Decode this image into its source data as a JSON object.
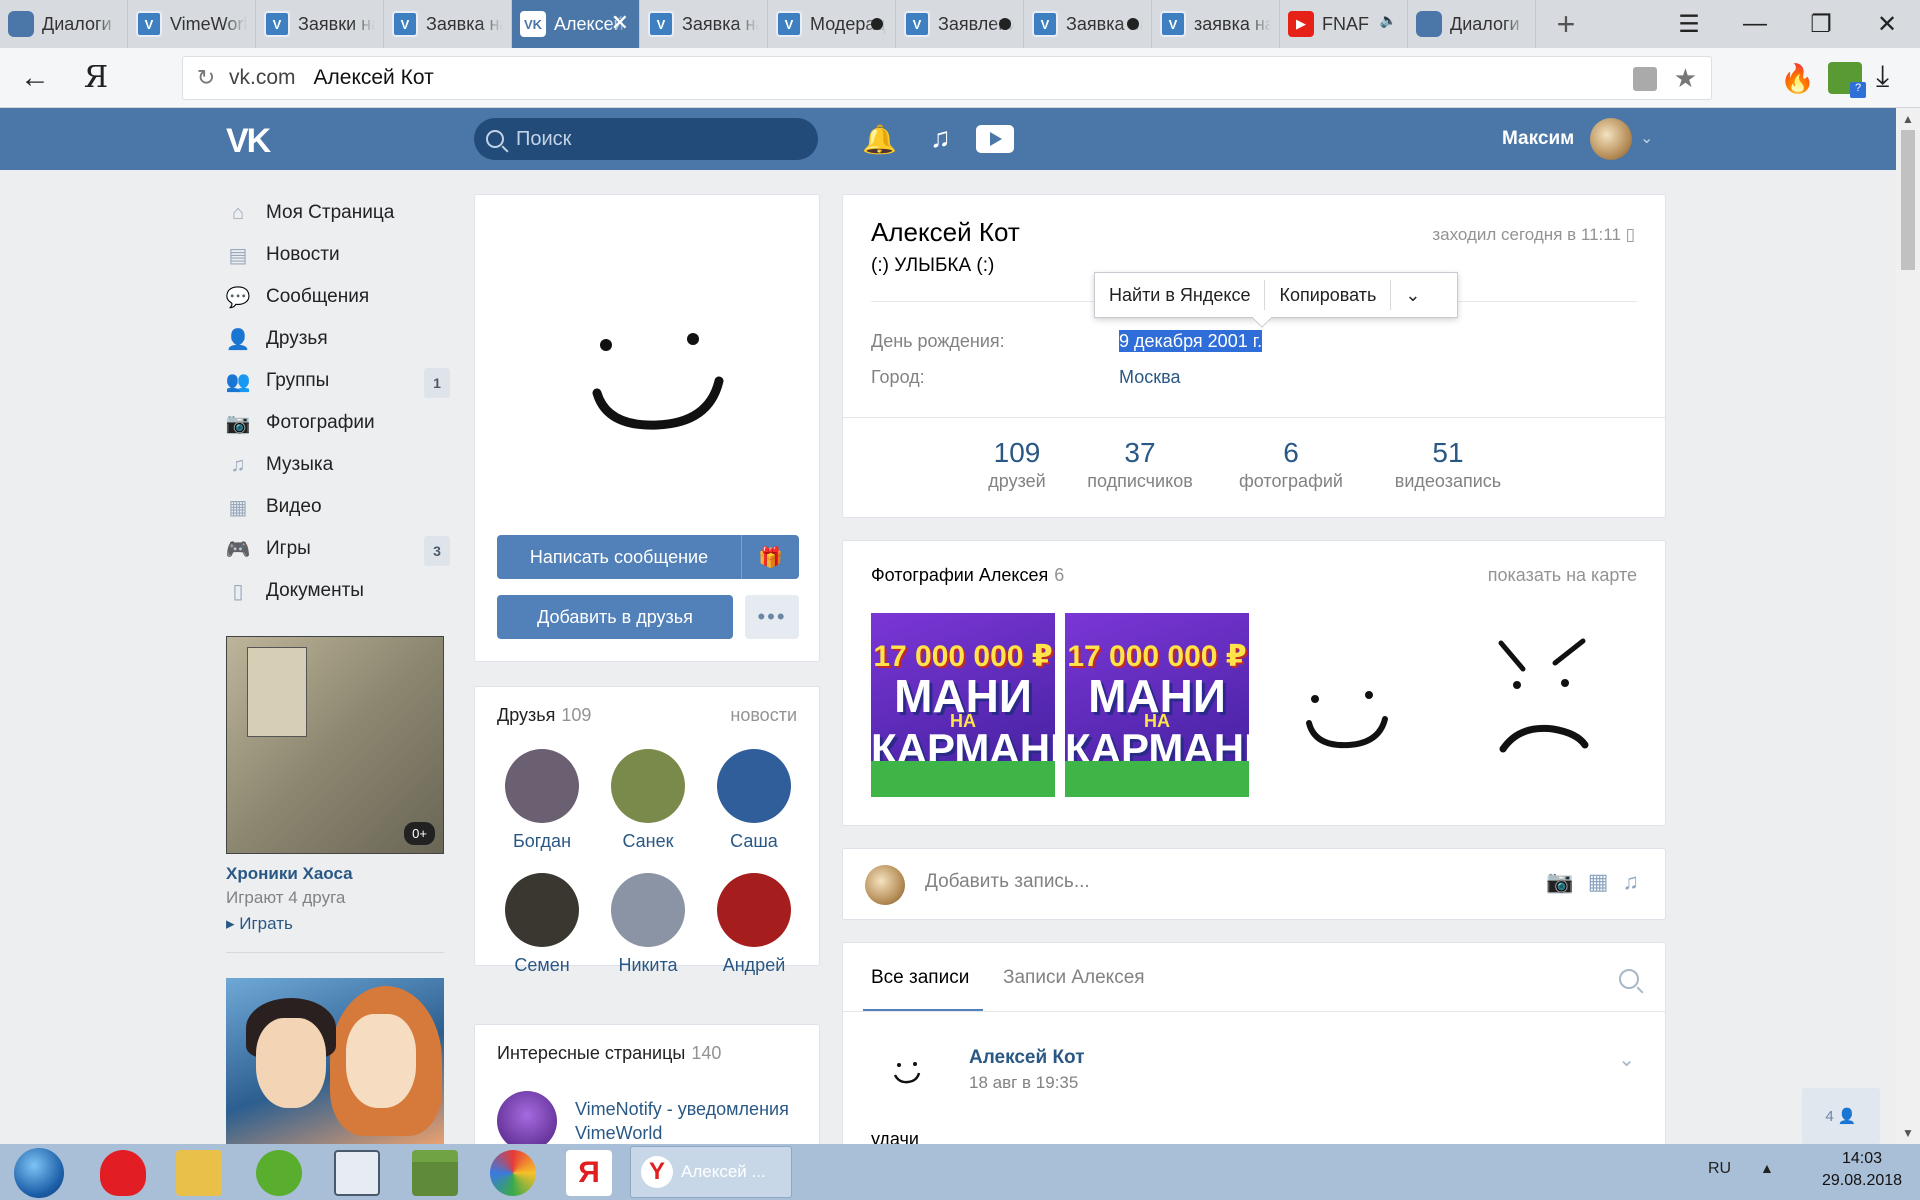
{
  "browser": {
    "tabs": [
      {
        "label": "Диалоги",
        "icon": "dialogs-icon"
      },
      {
        "label": "VimeWorld",
        "icon": "vimeworld-icon"
      },
      {
        "label": "Заявки на",
        "icon": "vimeworld-icon"
      },
      {
        "label": "Заявка на",
        "icon": "vimeworld-icon"
      },
      {
        "label": "Алексей Кот",
        "icon": "vk-icon",
        "active": true
      },
      {
        "label": "Заявка на",
        "icon": "vimeworld-icon"
      },
      {
        "label": "Модерация",
        "icon": "vimeworld-icon"
      },
      {
        "label": "Заявление",
        "icon": "vimeworld-icon"
      },
      {
        "label": "Заявка на",
        "icon": "vimeworld-icon"
      },
      {
        "label": "заявка на",
        "icon": "vimeworld-icon"
      },
      {
        "label": "FNAF",
        "icon": "youtube-icon"
      },
      {
        "label": "Диалоги",
        "icon": "dialogs-icon"
      }
    ],
    "address": {
      "domain": "vk.com",
      "title": "Алексей Кот"
    },
    "yandex_button": "Я"
  },
  "vk_header": {
    "logo": "VK",
    "search_placeholder": "Поиск",
    "user_name": "Максим"
  },
  "left_menu": {
    "items": [
      {
        "label": "Моя Страница",
        "icon": "home-icon"
      },
      {
        "label": "Новости",
        "icon": "news-icon"
      },
      {
        "label": "Сообщения",
        "icon": "messages-icon"
      },
      {
        "label": "Друзья",
        "icon": "friends-icon"
      },
      {
        "label": "Группы",
        "icon": "groups-icon",
        "badge": "1"
      },
      {
        "label": "Фотографии",
        "icon": "camera-icon"
      },
      {
        "label": "Музыка",
        "icon": "music-icon"
      },
      {
        "label": "Видео",
        "icon": "video-icon"
      },
      {
        "label": "Игры",
        "icon": "gamepad-icon",
        "badge": "3"
      },
      {
        "label": "Документы",
        "icon": "document-icon"
      }
    ],
    "game": {
      "title": "Хроники Хаоса",
      "friends": "Играют 4 друга",
      "play": "Играть",
      "age": "0+"
    }
  },
  "profile": {
    "name": "Алексей Кот",
    "status": "(:) УЛЫБКА (:)",
    "online": "заходил сегодня в 11:11",
    "info": [
      {
        "label": "День рождения:",
        "value": "9 декабря 2001 г."
      },
      {
        "label": "Город:",
        "value": "Москва"
      }
    ],
    "stats": [
      {
        "num": "109",
        "label": "друзей"
      },
      {
        "num": "37",
        "label": "подписчиков"
      },
      {
        "num": "6",
        "label": "фотографий"
      },
      {
        "num": "51",
        "label": "видеозапись"
      }
    ],
    "buttons": {
      "message": "Написать сообщение",
      "add_friend": "Добавить в друзья",
      "more": "•••"
    }
  },
  "context_menu": {
    "find": "Найти в Яндексе",
    "copy": "Копировать"
  },
  "friends": {
    "title": "Друзья",
    "count": "109",
    "link": "новости",
    "items": [
      {
        "name": "Богдан",
        "color": "#6b5f72"
      },
      {
        "name": "Санек",
        "color": "#7a8a4a"
      },
      {
        "name": "Саша",
        "color": "#2f5e9a"
      },
      {
        "name": "Семен",
        "color": "#3a3630"
      },
      {
        "name": "Никита",
        "color": "#8a94a4"
      },
      {
        "name": "Андрей",
        "color": "#a51d1d"
      }
    ]
  },
  "interesting_pages": {
    "title": "Интересные страницы",
    "count": "140",
    "items": [
      {
        "title": "VimeNotify - уведомления VimeWorld"
      }
    ]
  },
  "photos": {
    "title": "Фотографии Алексея",
    "count": "6",
    "map_link": "показать на карте",
    "promo": {
      "amount": "17 000 000 ₽",
      "line1": "МАНИ",
      "line2": "НА",
      "line3": "КАРМАНЕ"
    }
  },
  "post_box": {
    "placeholder": "Добавить запись..."
  },
  "wall": {
    "tab_all": "Все записи",
    "tab_own": "Записи Алексея",
    "post": {
      "author": "Алексей Кот",
      "date": "18 авг в 19:35",
      "text": "удачи"
    }
  },
  "online_chip": "4",
  "taskbar": {
    "active_label": "Алексей ...",
    "lang": "RU",
    "time": "14:03",
    "date": "29.08.2018"
  }
}
